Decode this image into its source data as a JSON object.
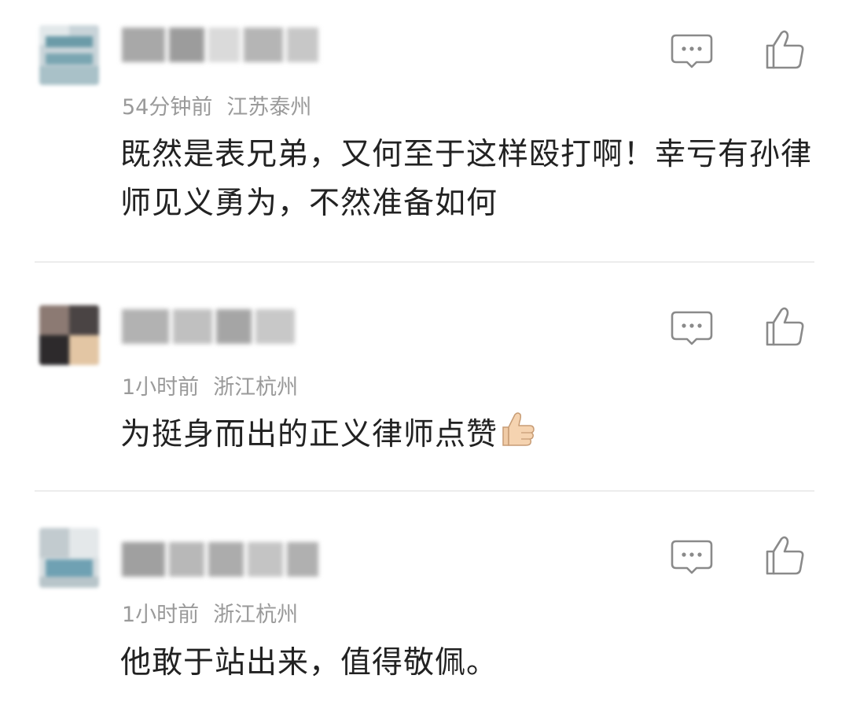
{
  "comments": [
    {
      "time": "54分钟前",
      "location": "江苏泰州",
      "text": "既然是表兄弟，又何至于这样殴打啊！幸亏有孙律师见义勇为，不然准备如何",
      "emoji": null
    },
    {
      "time": "1小时前",
      "location": "浙江杭州",
      "text": "为挺身而出的正义律师点赞",
      "emoji": "thumbs-up"
    },
    {
      "time": "1小时前",
      "location": "浙江杭州",
      "text": "他敢于站出来，值得敬佩。",
      "emoji": null
    }
  ],
  "colors": {
    "meta_text": "#9a9a9a",
    "body_text": "#222222",
    "icon_stroke": "#8a8a8a",
    "divider": "#ececec"
  },
  "icons": {
    "reply": "comment-bubble-icon",
    "like": "thumbs-up-outline-icon"
  }
}
